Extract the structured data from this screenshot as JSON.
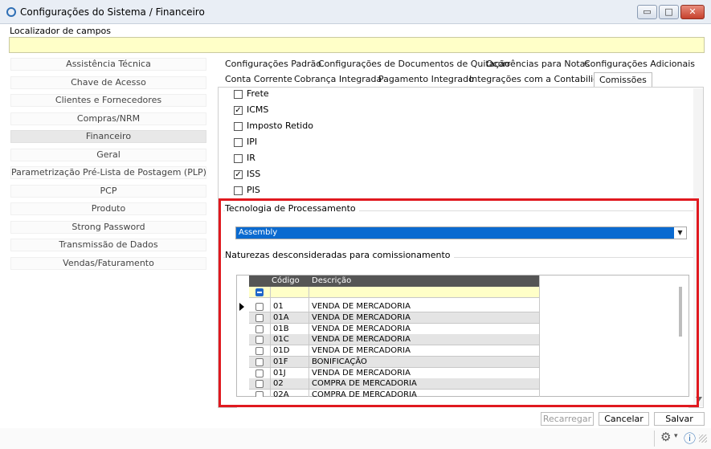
{
  "window": {
    "title": "Configurações do Sistema / Financeiro",
    "controls": {
      "minimize": "▭",
      "maximize": "□",
      "close": "✕"
    }
  },
  "locator": {
    "label": "Localizador de campos",
    "value": ""
  },
  "sidebar": {
    "items": [
      {
        "label": "Assistência Técnica"
      },
      {
        "label": "Chave de Acesso"
      },
      {
        "label": "Clientes e Fornecedores"
      },
      {
        "label": "Compras/NRM"
      },
      {
        "label": "Financeiro",
        "active": true
      },
      {
        "label": "Geral"
      },
      {
        "label": "Parametrização Pré-Lista de Postagem (PLP)"
      },
      {
        "label": "PCP"
      },
      {
        "label": "Produto"
      },
      {
        "label": "Strong Password"
      },
      {
        "label": "Transmissão de Dados"
      },
      {
        "label": "Vendas/Faturamento"
      }
    ]
  },
  "tabs": {
    "row1": [
      {
        "label": "Configurações Padrão"
      },
      {
        "label": "Configurações de Documentos de Quitação"
      },
      {
        "label": "Ocorrências para Notas"
      },
      {
        "label": "Configurações Adicionais"
      }
    ],
    "row2": [
      {
        "label": "Conta Corrente"
      },
      {
        "label": "Cobrança Integrada"
      },
      {
        "label": "Pagamento Integrado"
      },
      {
        "label": "Integrações com a Contabilidade"
      },
      {
        "label": "Comissões",
        "active": true
      }
    ]
  },
  "taxes": [
    {
      "label": "Frete",
      "checked": false
    },
    {
      "label": "ICMS",
      "checked": true
    },
    {
      "label": "Imposto Retido",
      "checked": false
    },
    {
      "label": "IPI",
      "checked": false
    },
    {
      "label": "IR",
      "checked": false
    },
    {
      "label": "ISS",
      "checked": true
    },
    {
      "label": "PIS",
      "checked": false
    }
  ],
  "tecnologia": {
    "label": "Tecnologia de Processamento",
    "value": "Assembly",
    "check_mark": "✓"
  },
  "naturezas": {
    "label": "Naturezas desconsideradas para comissionamento",
    "columns": {
      "codigo": "Código",
      "descricao": "Descrição"
    },
    "rows": [
      {
        "codigo": "01",
        "descricao": "VENDA DE MERCADORIA"
      },
      {
        "codigo": "01A",
        "descricao": "VENDA DE MERCADORIA"
      },
      {
        "codigo": "01B",
        "descricao": "VENDA DE MERCADORIA"
      },
      {
        "codigo": "01C",
        "descricao": "VENDA DE MERCADORIA"
      },
      {
        "codigo": "01D",
        "descricao": "VENDA DE MERCADORIA"
      },
      {
        "codigo": "01F",
        "descricao": "BONIFICAÇÃO"
      },
      {
        "codigo": "01J",
        "descricao": "VENDA DE MERCADORIA"
      },
      {
        "codigo": "02",
        "descricao": "COMPRA DE MERCADORIA"
      },
      {
        "codigo": "02A",
        "descricao": "COMPRA DE MERCADORIA"
      }
    ]
  },
  "buttons": {
    "recarregar": "Recarregar",
    "cancelar": "Cancelar",
    "salvar": "Salvar"
  },
  "statusbar": {
    "settings_icon": "⚙",
    "dropdown_icon": "▾",
    "info_icon": "ⓘ"
  },
  "colors": {
    "highlight_box": "#e0191f",
    "selection": "#0a6ad0",
    "filter_row": "#ffffc8",
    "grid_header": "#555555"
  }
}
